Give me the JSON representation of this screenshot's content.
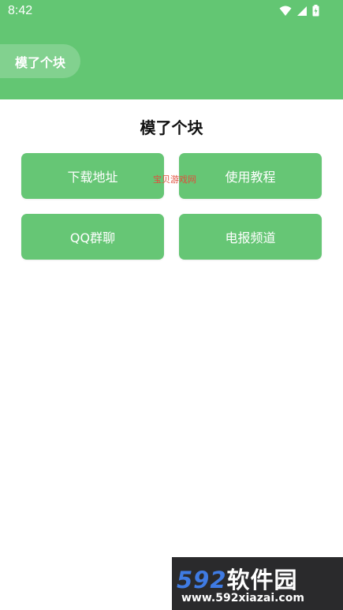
{
  "status_bar": {
    "time": "8:42",
    "icons": [
      "wifi-icon",
      "signal-icon",
      "battery-charging-icon"
    ]
  },
  "header": {
    "title": "模了个块",
    "background": "#63c673"
  },
  "main": {
    "title": "模了个块",
    "buttons": [
      {
        "label": "下载地址"
      },
      {
        "label": "使用教程"
      },
      {
        "label": "QQ群聊"
      },
      {
        "label": "电报频道"
      }
    ],
    "button_color": "#66c675"
  },
  "overlay": {
    "site_text": "宝贝游戏网"
  },
  "watermark": {
    "logo_number": "592",
    "logo_text": "软件园",
    "url": "www.592xiazai.com"
  }
}
